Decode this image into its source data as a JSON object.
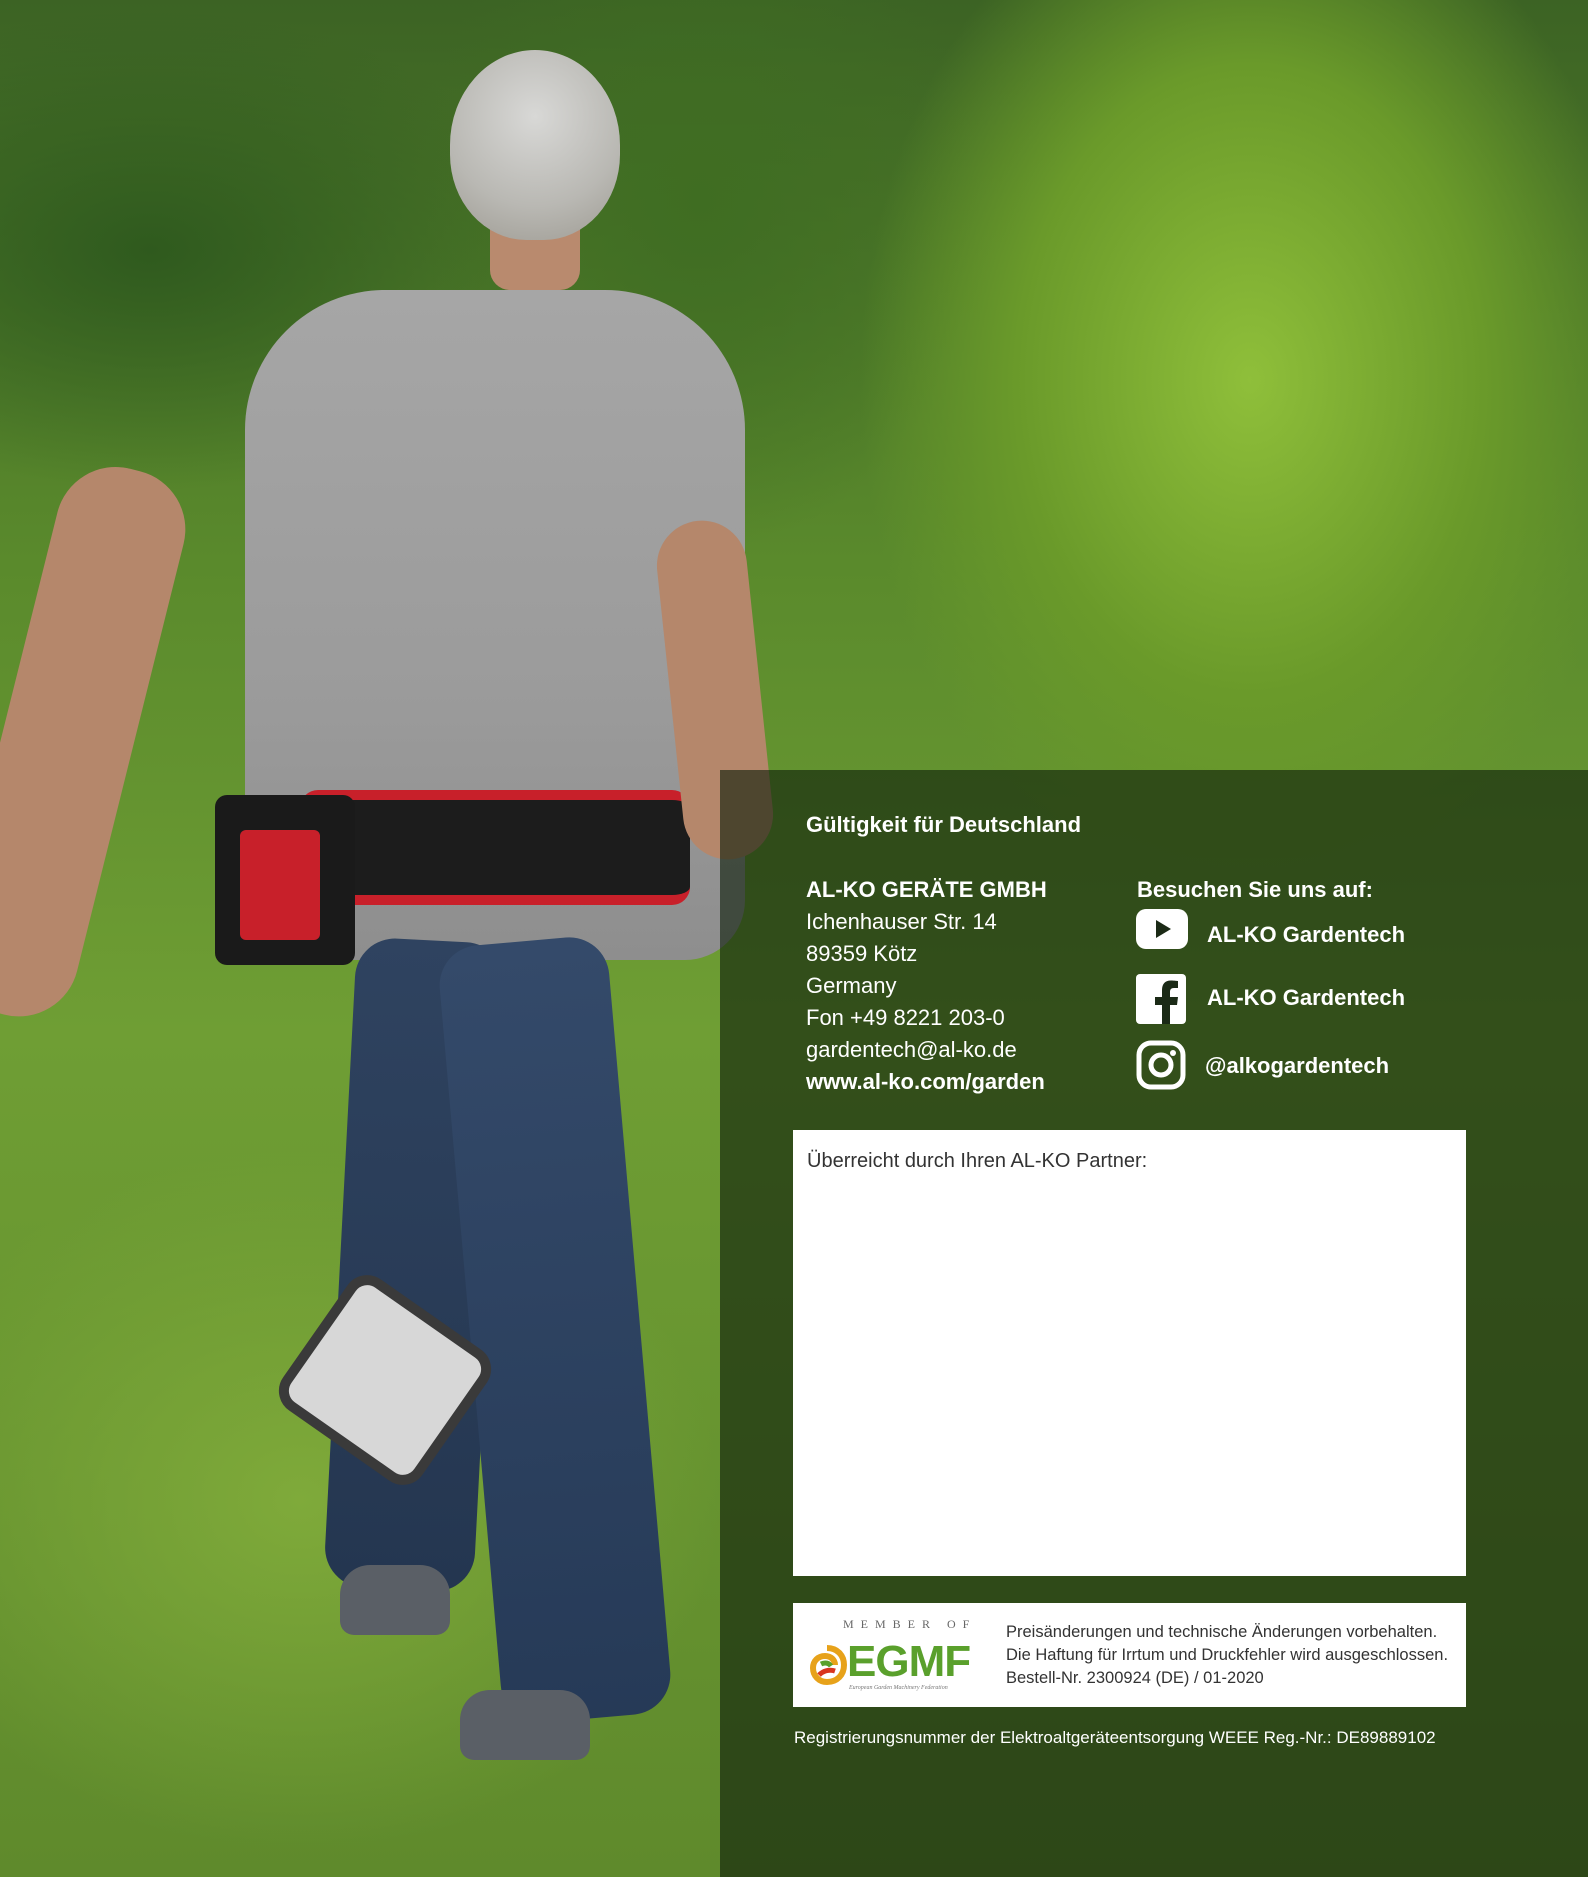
{
  "validity_heading": "Gültigkeit für Deutschland",
  "company": {
    "name": "AL-KO GERÄTE GMBH",
    "street": "Ichenhauser Str. 14",
    "city": "89359 Kötz",
    "country": "Germany",
    "phone": "Fon +49 8221 203-0",
    "email": "gardentech@al-ko.de",
    "website": "www.al-ko.com/garden"
  },
  "social": {
    "heading": "Besuchen Sie uns auf:",
    "items": [
      {
        "icon": "youtube-icon",
        "label": "AL-KO Gardentech"
      },
      {
        "icon": "facebook-icon",
        "label": "AL-KO Gardentech"
      },
      {
        "icon": "instagram-icon",
        "label": "@alkogardentech"
      }
    ]
  },
  "partner": {
    "label": "Überreicht durch Ihren AL-KO Partner:"
  },
  "egmf": {
    "member_of": "MEMBER OF",
    "name": "EGMF",
    "subtitle": "European Garden Machinery Federation"
  },
  "legal": {
    "line1": "Preisänderungen und technische Änderungen vorbehalten.",
    "line2": "Die Haftung für Irrtum und Druckfehler wird ausgeschlossen.",
    "line3": "Bestell-Nr. 2300924 (DE) / 01-2020"
  },
  "weee": "Registrierungsnummer der Elektroaltgeräteentsorgung WEEE Reg.-Nr.: DE89889102",
  "colors": {
    "panel_overlay": "#0e1e0c",
    "egmf_green": "#5aa02c",
    "belt_red": "#c8202a"
  }
}
